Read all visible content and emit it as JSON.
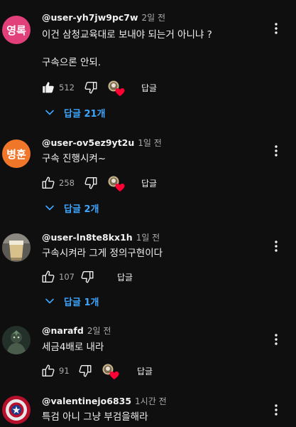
{
  "comments": [
    {
      "avatar_text": "영록",
      "author": "@user-yh7jw9pc7w",
      "time": "2일 전",
      "text_line1": "이건 삼청교육대로 보내야 되는거 아니냐 ?",
      "text_line2": "구속으론 안되.",
      "likes": "512",
      "reply_label": "답글",
      "replies_label": "답글 21개",
      "like_filled": true
    },
    {
      "avatar_text": "병훈",
      "author": "@user-ov5ez9yt2u",
      "time": "1일 전",
      "text_line1": "구속  진행시켜~",
      "likes": "258",
      "reply_label": "답글",
      "replies_label": "답글 2개"
    },
    {
      "author": "@user-ln8te8kx1h",
      "time": "1일 전",
      "text_line1": "구속시켜라 그게 정의구현이다",
      "likes": "107",
      "reply_label": "답글",
      "replies_label": "답글 1개"
    },
    {
      "author": "@narafd",
      "time": "2일 전",
      "text_line1": "세금4배로 내라",
      "likes": "91",
      "reply_label": "답글"
    },
    {
      "author": "@valentinejo6835",
      "time": "1시간 전",
      "text_line1": "특검 아니 그냥 부검을해라"
    }
  ],
  "icons": {
    "like": "thumbs-up-icon",
    "dislike": "thumbs-down-icon",
    "more": "more-vertical-icon",
    "expand": "chevron-down-icon",
    "heart": "creator-heart-icon"
  },
  "colors": {
    "background": "#0f0f0f",
    "text": "#f1f1f1",
    "secondary_text": "#aaaaaa",
    "link": "#3ea6ff",
    "heart": "#ff0033"
  }
}
